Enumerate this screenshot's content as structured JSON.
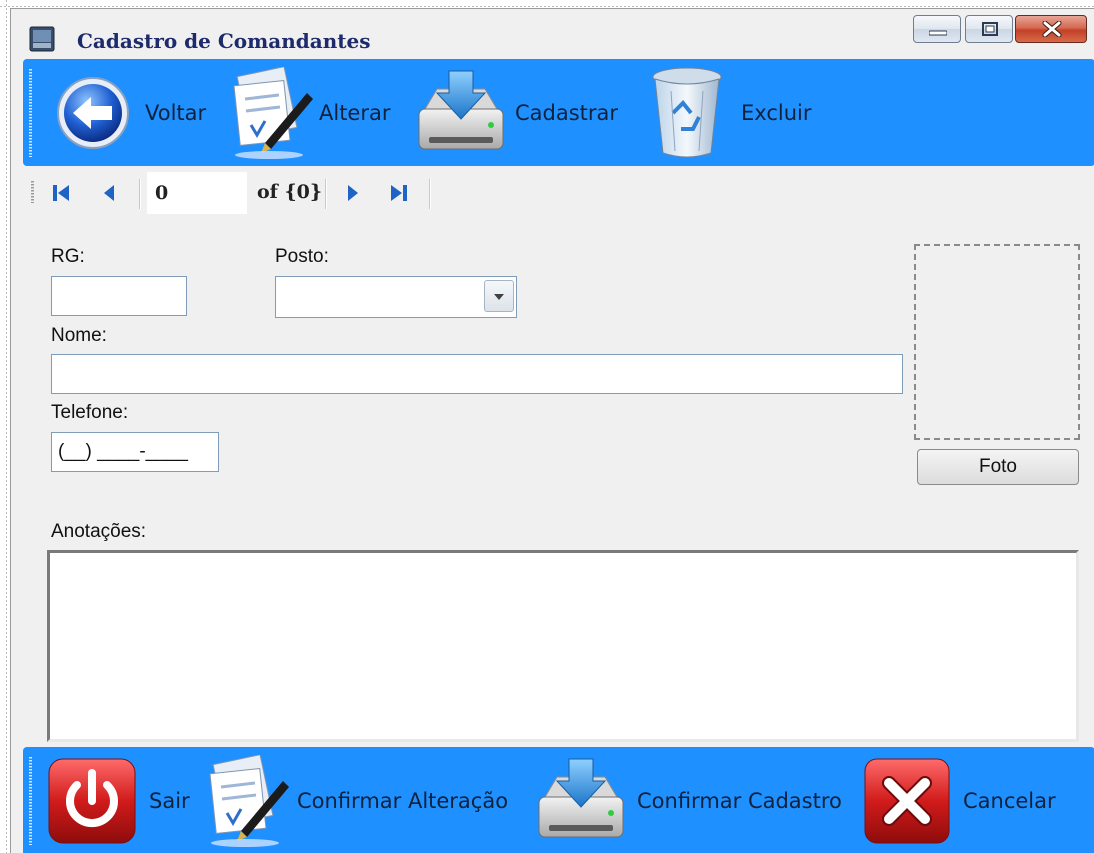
{
  "window": {
    "title": "Cadastro de Comandantes"
  },
  "toolbar_top": {
    "items": [
      {
        "label": "Voltar",
        "icon": "back-arrow-icon"
      },
      {
        "label": "Alterar",
        "icon": "edit-document-icon"
      },
      {
        "label": "Cadastrar",
        "icon": "download-drive-icon"
      },
      {
        "label": "Excluir",
        "icon": "recycle-bin-icon"
      }
    ]
  },
  "navigator": {
    "position": "0",
    "count_text": "of {0}"
  },
  "form": {
    "rg_label": "RG:",
    "rg_value": "",
    "posto_label": "Posto:",
    "posto_value": "",
    "nome_label": "Nome:",
    "nome_value": "",
    "telefone_label": "Telefone:",
    "telefone_mask": "(__) ____-____",
    "foto_button": "Foto",
    "anotacoes_label": "Anotações:",
    "anotacoes_value": ""
  },
  "toolbar_bottom": {
    "items": [
      {
        "label": "Sair",
        "icon": "power-icon"
      },
      {
        "label": "Confirmar Alteração",
        "icon": "edit-document-icon"
      },
      {
        "label": "Confirmar Cadastro",
        "icon": "download-drive-icon"
      },
      {
        "label": "Cancelar",
        "icon": "cancel-x-icon"
      }
    ]
  },
  "colors": {
    "toolbar_blue": "#1e90ff",
    "title_text": "#1d2a6b",
    "window_bg": "#f0f0f0"
  }
}
